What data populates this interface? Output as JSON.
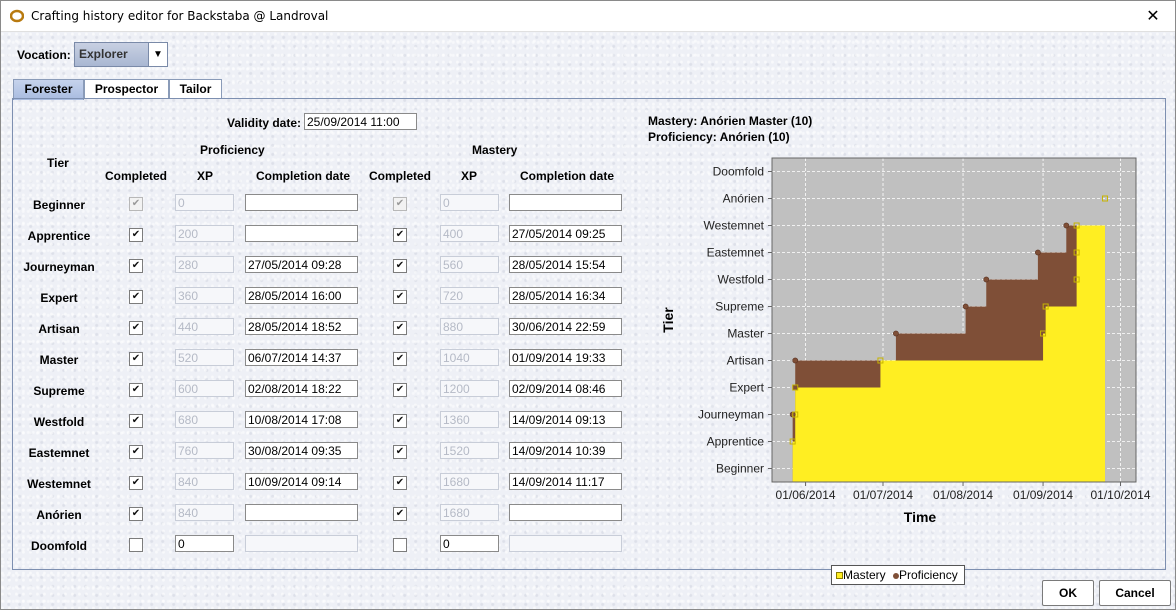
{
  "window": {
    "title": "Crafting history editor for Backstaba @ Landroval",
    "close_glyph": "✕"
  },
  "vocation": {
    "label": "Vocation:",
    "value": "Explorer"
  },
  "tabs": [
    {
      "label": "Forester"
    },
    {
      "label": "Prospector"
    },
    {
      "label": "Tailor"
    }
  ],
  "validity": {
    "label": "Validity date:",
    "value": "25/09/2014 11:00"
  },
  "headers": {
    "tier": "Tier",
    "proficiency": "Proficiency",
    "mastery": "Mastery",
    "completed": "Completed",
    "xp": "XP",
    "completion_date": "Completion date"
  },
  "rows": [
    {
      "tier": "Beginner",
      "p_done": true,
      "p_xp": "0",
      "p_date": "",
      "m_done": true,
      "m_xp": "0",
      "m_date": ""
    },
    {
      "tier": "Apprentice",
      "p_done": true,
      "p_xp": "200",
      "p_date": "",
      "m_done": true,
      "m_xp": "400",
      "m_date": "27/05/2014 09:25"
    },
    {
      "tier": "Journeyman",
      "p_done": true,
      "p_xp": "280",
      "p_date": "27/05/2014 09:28",
      "m_done": true,
      "m_xp": "560",
      "m_date": "28/05/2014 15:54"
    },
    {
      "tier": "Expert",
      "p_done": true,
      "p_xp": "360",
      "p_date": "28/05/2014 16:00",
      "m_done": true,
      "m_xp": "720",
      "m_date": "28/05/2014 16:34"
    },
    {
      "tier": "Artisan",
      "p_done": true,
      "p_xp": "440",
      "p_date": "28/05/2014 18:52",
      "m_done": true,
      "m_xp": "880",
      "m_date": "30/06/2014 22:59"
    },
    {
      "tier": "Master",
      "p_done": true,
      "p_xp": "520",
      "p_date": "06/07/2014 14:37",
      "m_done": true,
      "m_xp": "1040",
      "m_date": "01/09/2014 19:33"
    },
    {
      "tier": "Supreme",
      "p_done": true,
      "p_xp": "600",
      "p_date": "02/08/2014 18:22",
      "m_done": true,
      "m_xp": "1200",
      "m_date": "02/09/2014 08:46"
    },
    {
      "tier": "Westfold",
      "p_done": true,
      "p_xp": "680",
      "p_date": "10/08/2014 17:08",
      "m_done": true,
      "m_xp": "1360",
      "m_date": "14/09/2014 09:13"
    },
    {
      "tier": "Eastemnet",
      "p_done": true,
      "p_xp": "760",
      "p_date": "30/08/2014 09:35",
      "m_done": true,
      "m_xp": "1520",
      "m_date": "14/09/2014 10:39"
    },
    {
      "tier": "Westemnet",
      "p_done": true,
      "p_xp": "840",
      "p_date": "10/09/2014 09:14",
      "m_done": true,
      "m_xp": "1680",
      "m_date": "14/09/2014 11:17"
    },
    {
      "tier": "Anórien",
      "p_done": true,
      "p_xp": "840",
      "p_date": "",
      "m_done": true,
      "m_xp": "1680",
      "m_date": ""
    },
    {
      "tier": "Doomfold",
      "p_done": false,
      "p_xp": "0",
      "p_date": "",
      "m_done": false,
      "m_xp": "0",
      "m_date": ""
    }
  ],
  "chart_info": {
    "mastery": "Mastery: Anórien Master (10)",
    "proficiency": "Proficiency: Anórien (10)"
  },
  "chart_data": {
    "type": "area",
    "xlabel": "Time",
    "ylabel": "Tier",
    "y_categories": [
      "Beginner",
      "Apprentice",
      "Journeyman",
      "Expert",
      "Artisan",
      "Master",
      "Supreme",
      "Westfold",
      "Eastemnet",
      "Westemnet",
      "Anórien",
      "Doomfold"
    ],
    "x_ticks": [
      "01/06/2014",
      "01/07/2014",
      "01/08/2014",
      "01/09/2014",
      "01/10/2014"
    ],
    "xlim": [
      "2014-05-19",
      "2014-10-07"
    ],
    "grid": true,
    "legend_position": "bottom",
    "series": [
      {
        "name": "Mastery",
        "color": "#ffee22",
        "marker": "square",
        "points": [
          [
            "2014-05-27",
            1
          ],
          [
            "2014-05-28",
            2
          ],
          [
            "2014-05-28",
            3
          ],
          [
            "2014-06-30",
            4
          ],
          [
            "2014-09-01",
            5
          ],
          [
            "2014-09-02",
            6
          ],
          [
            "2014-09-14",
            7
          ],
          [
            "2014-09-14",
            8
          ],
          [
            "2014-09-14",
            9
          ],
          [
            "2014-09-25",
            10
          ]
        ]
      },
      {
        "name": "Proficiency",
        "color": "#7f4f37",
        "marker": "circle",
        "points": [
          [
            "2014-05-27",
            2
          ],
          [
            "2014-05-28",
            3
          ],
          [
            "2014-05-28",
            4
          ],
          [
            "2014-07-06",
            5
          ],
          [
            "2014-08-02",
            6
          ],
          [
            "2014-08-10",
            7
          ],
          [
            "2014-08-30",
            8
          ],
          [
            "2014-09-10",
            9
          ]
        ]
      }
    ],
    "plot_bg": "#c0c0c0"
  },
  "buttons": {
    "ok": "OK",
    "cancel": "Cancel"
  }
}
